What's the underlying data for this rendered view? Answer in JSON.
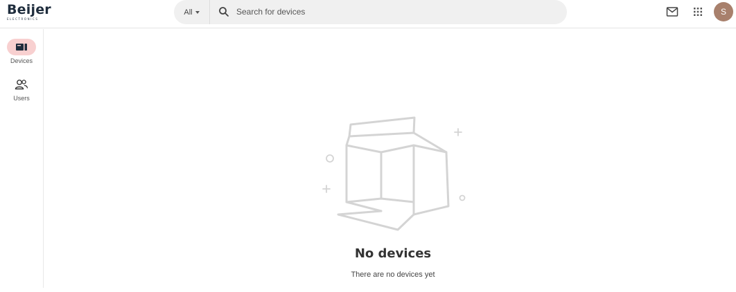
{
  "brand": {
    "name": "Beijer",
    "tagline": "ELECTRONICS"
  },
  "search": {
    "scope_label": "All",
    "placeholder": "Search for devices",
    "value": ""
  },
  "header": {
    "icons": [
      "mail-icon",
      "apps-grid-icon"
    ],
    "avatar_initial": "S",
    "avatar_color": "#a8806c"
  },
  "sidebar": {
    "items": [
      {
        "label": "Devices",
        "icon": "device-icon",
        "active": true
      },
      {
        "label": "Users",
        "icon": "users-icon",
        "active": false
      }
    ],
    "active_color": "#f8d0d0"
  },
  "empty_state": {
    "title": "No devices",
    "subtitle": "There are no devices yet",
    "illustration": "empty-box-icon"
  }
}
